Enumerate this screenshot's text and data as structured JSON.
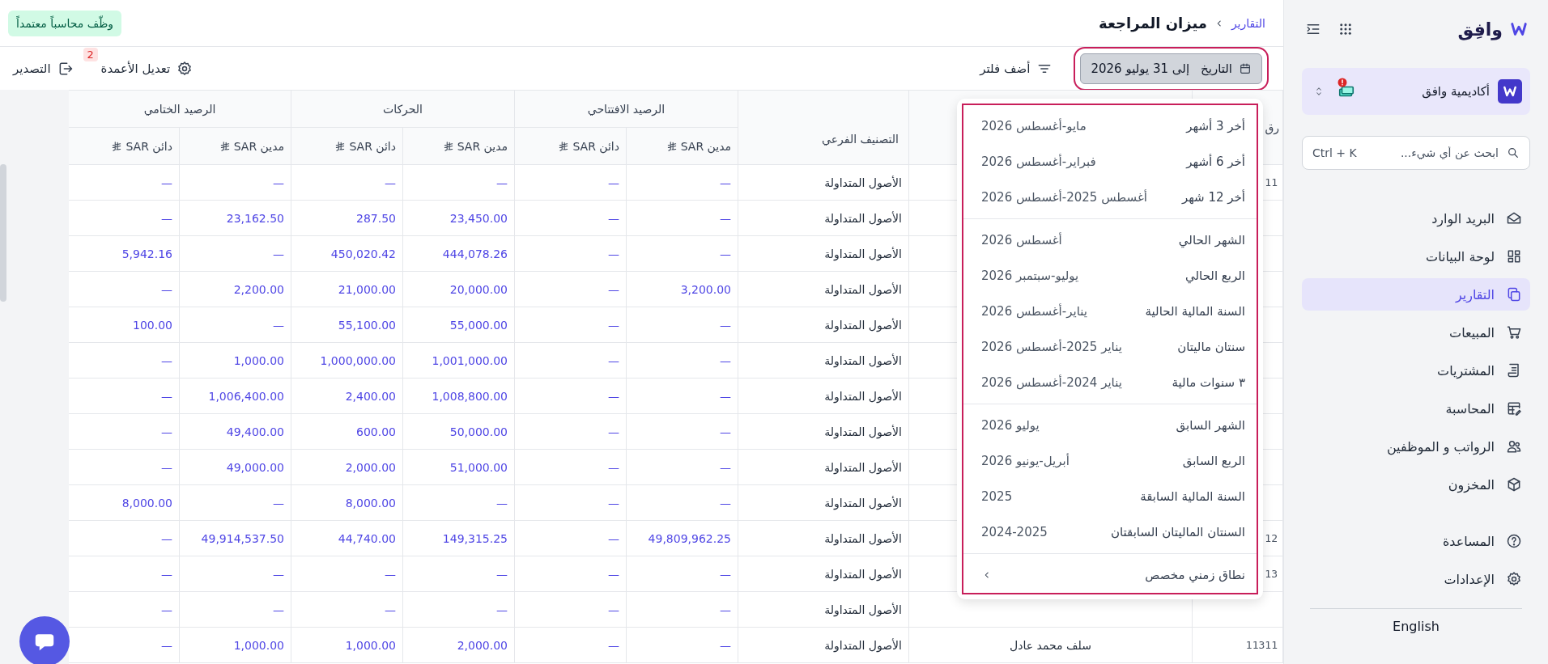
{
  "sidebar": {
    "logo": "وافِق",
    "org": {
      "name": "أكاديمية وافق",
      "alert": true
    },
    "search": {
      "placeholder": "ابحث عن أي شيء...",
      "shortcut": "Ctrl + K"
    },
    "nav": [
      {
        "label": "البريد الوارد",
        "kind": "inbox",
        "selected": false
      },
      {
        "label": "لوحة البيانات",
        "kind": "dashboard",
        "selected": false
      },
      {
        "label": "التقارير",
        "kind": "reports",
        "selected": true
      },
      {
        "label": "المبيعات",
        "kind": "sales",
        "selected": false
      },
      {
        "label": "المشتريات",
        "kind": "purchases",
        "selected": false
      },
      {
        "label": "المحاسبة",
        "kind": "accounting",
        "selected": false
      },
      {
        "label": "الرواتب و الموظفين",
        "kind": "payroll",
        "selected": false
      },
      {
        "label": "المخزون",
        "kind": "inventory",
        "selected": false
      }
    ],
    "footer_nav": [
      {
        "label": "المساعدة",
        "kind": "help",
        "selected": false
      },
      {
        "label": "الإعدادات",
        "kind": "settings",
        "selected": false
      }
    ],
    "language": "English"
  },
  "header": {
    "breadcrumb": [
      {
        "label": "التقارير"
      },
      {
        "label": "ميزان المراجعة"
      }
    ],
    "promo": "وظّف محاسباً معتمداً"
  },
  "toolbar": {
    "date_button": {
      "label": "التاريخ",
      "value": "إلى 31 يوليو 2026",
      "focused": true
    },
    "add_filter": "أضف فلتر",
    "edit_columns": {
      "label": "تعديل الأعمدة",
      "badge": "2"
    },
    "export": "التصدير"
  },
  "table": {
    "header": {
      "column_1": "رق",
      "subcategory": "التصنيف الفرعي",
      "groups": [
        {
          "label": "الرصيد الافتتاحي",
          "subcolumns": [
            "مدين SAR",
            "دائن SAR"
          ]
        },
        {
          "label": "الحركات",
          "subcolumns": [
            "مدين SAR",
            "دائن SAR"
          ]
        },
        {
          "label": "الرصيد الختامي",
          "subcolumns": [
            "مدين SAR",
            "دائن SAR"
          ]
        }
      ]
    },
    "rows": [
      {
        "column_1": "11",
        "subcategory": "الأصول المتداولة",
        "amounts": [
          "—",
          "—",
          "—",
          "—",
          "—",
          "—"
        ]
      },
      {
        "subcategory": "الأصول المتداولة",
        "amounts": [
          "—",
          "—",
          "23,450.00",
          "287.50",
          "23,162.50",
          "—"
        ]
      },
      {
        "subcategory": "الأصول المتداولة",
        "amounts": [
          "—",
          "—",
          "444,078.26",
          "450,020.42",
          "—",
          "5,942.16"
        ]
      },
      {
        "subcategory": "الأصول المتداولة",
        "amounts": [
          "3,200.00",
          "—",
          "20,000.00",
          "21,000.00",
          "2,200.00",
          "—"
        ]
      },
      {
        "subcategory": "الأصول المتداولة",
        "amounts": [
          "—",
          "—",
          "55,000.00",
          "55,100.00",
          "—",
          "100.00"
        ]
      },
      {
        "subcategory": "الأصول المتداولة",
        "amounts": [
          "—",
          "—",
          "1,001,000.00",
          "1,000,000.00",
          "1,000.00",
          "—"
        ]
      },
      {
        "subcategory": "الأصول المتداولة",
        "amounts": [
          "—",
          "—",
          "1,008,800.00",
          "2,400.00",
          "1,006,400.00",
          "—"
        ]
      },
      {
        "subcategory": "الأصول المتداولة",
        "amounts": [
          "—",
          "—",
          "50,000.00",
          "600.00",
          "49,400.00",
          "—"
        ]
      },
      {
        "subcategory": "الأصول المتداولة",
        "amounts": [
          "—",
          "—",
          "51,000.00",
          "2,000.00",
          "49,000.00",
          "—"
        ]
      },
      {
        "subcategory": "الأصول المتداولة",
        "amounts": [
          "—",
          "—",
          "—",
          "8,000.00",
          "—",
          "8,000.00"
        ]
      },
      {
        "column_1": "12",
        "subcategory": "الأصول المتداولة",
        "amounts": [
          "49,809,962.25",
          "—",
          "149,315.25",
          "44,740.00",
          "49,914,537.50",
          "—"
        ]
      },
      {
        "column_1": "13",
        "subcategory": "الأصول المتداولة",
        "amounts": [
          "—",
          "—",
          "—",
          "—",
          "—",
          "—"
        ]
      },
      {
        "subcategory": "الأصول المتداولة",
        "amounts": [
          "—",
          "—",
          "—",
          "—",
          "—",
          "—"
        ]
      },
      {
        "column_1": "11311",
        "column_2": "سلف محمد عادل",
        "subcategory": "الأصول المتداولة",
        "amounts": [
          "—",
          "—",
          "2,000.00",
          "1,000.00",
          "1,000.00",
          "—"
        ]
      }
    ]
  },
  "date_menu": {
    "groups": [
      [
        {
          "label": "أخر 3 أشهر",
          "range": "مايو-أغسطس 2026"
        },
        {
          "label": "أخر 6 أشهر",
          "range": "فبراير-أغسطس 2026"
        },
        {
          "label": "أخر 12 شهر",
          "range": "أغسطس 2025-أغسطس 2026"
        }
      ],
      [
        {
          "label": "الشهر الحالي",
          "range": "أغسطس 2026"
        },
        {
          "label": "الربع الحالي",
          "range": "يوليو-سبتمبر 2026"
        },
        {
          "label": "السنة المالية الحالية",
          "range": "يناير-أغسطس 2026"
        },
        {
          "label": "سنتان ماليتان",
          "range": "يناير 2025-أغسطس 2026"
        },
        {
          "label": "٣ سنوات مالية",
          "range": "يناير 2024-أغسطس 2026"
        }
      ],
      [
        {
          "label": "الشهر السابق",
          "range": "يوليو 2026"
        },
        {
          "label": "الربع السابق",
          "range": "أبريل-يونيو 2026"
        },
        {
          "label": "السنة المالية السابقة",
          "range": "2025"
        },
        {
          "label": "السنتان الماليتان السابقتان",
          "range": "2024-2025"
        }
      ]
    ],
    "custom": "نطاق زمني مخصص"
  }
}
